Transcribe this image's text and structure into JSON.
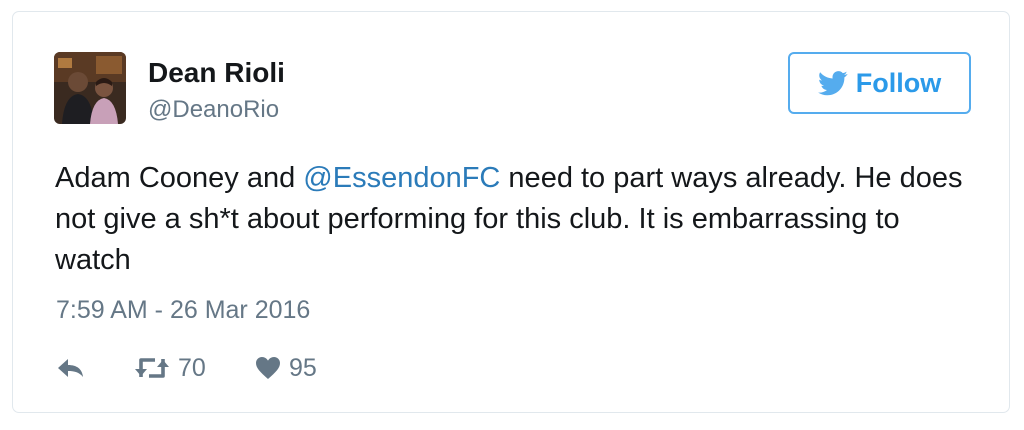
{
  "tweet": {
    "display_name": "Dean Rioli",
    "handle": "@DeanoRio",
    "follow_label": "Follow",
    "text_before_mention": "Adam Cooney and ",
    "mention": "@EssendonFC",
    "text_after_mention": " need to part ways already. He does not give a sh*t about performing for this club. It is embarrassing to watch",
    "timestamp": "7:59 AM - 26 Mar 2016",
    "retweet_count": "70",
    "like_count": "95"
  },
  "colors": {
    "brand_blue": "#55acee",
    "link_blue": "#2b7bb9",
    "muted_gray": "#657786",
    "text": "#14171a",
    "border": "#e1e8ed"
  },
  "icons": {
    "follow": "twitter-bird-icon",
    "reply": "reply-arrow-icon",
    "retweet": "retweet-icon",
    "like": "heart-icon"
  }
}
